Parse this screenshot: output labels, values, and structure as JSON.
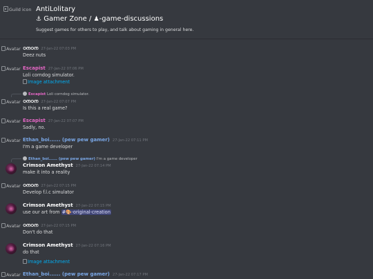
{
  "guild": {
    "icon_alt": "Guild icon",
    "name": "AntiLolitary",
    "category": "Gamer Zone",
    "separator": "/",
    "channel_icon": "♟",
    "channel_prefix": "⚓",
    "channel": "-game-discussions",
    "topic": "Suggest games for others to play, and talk about gaming in general here."
  },
  "avatar_alt": "Avatar",
  "attachment_label": "Image attachment",
  "colors": {
    "background": "#36393f",
    "timestamp": "#72767d",
    "link": "#00aff4",
    "onon": "#ffffff",
    "escapist": "#e667c6",
    "ethan": "#7aa7e6",
    "crimson": "#ffffff"
  },
  "messages": [
    {
      "author": "ഠനഠന",
      "time": "27-Jan-22 07:03 PM",
      "content": "Deez nuts"
    },
    {
      "author": "Escapist",
      "time": "27-Jan-22 07:06 PM",
      "content": "Loli corndog simulator.",
      "attachment": "Image attachment"
    },
    {
      "reply_author": "Escapist",
      "reply_text": "Loli corndog simulator.",
      "author": "ഠനഠന",
      "time": "27-Jan-22 07:07 PM",
      "content": "Is this a real game?"
    },
    {
      "author": "Escapist",
      "time": "27-Jan-22 07:07 PM",
      "content": "Sadly, no."
    },
    {
      "author": "Ethan_boi...... (pew pew gamer)",
      "time": "27-Jan-22 07:11 PM",
      "content": "I'm a game developer"
    },
    {
      "reply_author": "Ethan_boi...... (pew pew gamer)",
      "reply_text": "I'm a game developer",
      "author": "Crimson Amethyst",
      "time": "27-Jan-22 07:14 PM",
      "content": "make it into a reality"
    },
    {
      "author": "ഠനഠന",
      "time": "27-Jan-22 07:15 PM",
      "content": "Develop f.l.c simulator"
    },
    {
      "author": "Crimson Amethyst",
      "time": "27-Jan-22 07:15 PM",
      "content_prefix": "use our art from",
      "mention": "#🎨-original-creation"
    },
    {
      "author": "ഠനഠന",
      "time": "27-Jan-22 07:15 PM",
      "content": "Don't do that"
    },
    {
      "author": "Crimson Amethyst",
      "time": "27-Jan-22 07:16 PM",
      "content": "do that",
      "attachment": "Image attachment"
    },
    {
      "author": "Ethan_boi...... (pew pew gamer)",
      "time": "27-Jan-22 07:17 PM"
    }
  ]
}
